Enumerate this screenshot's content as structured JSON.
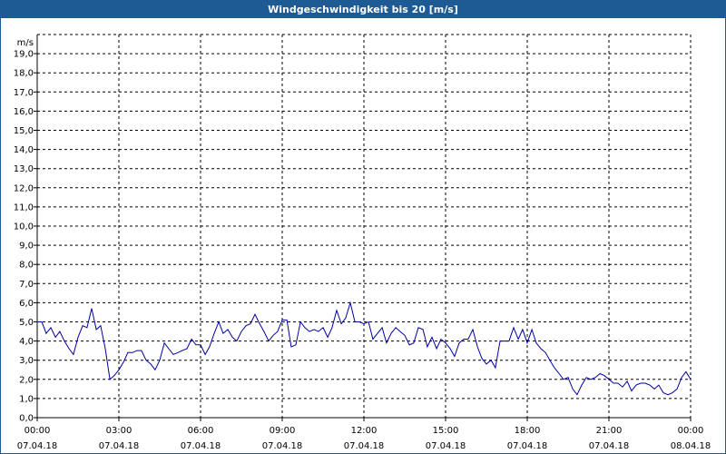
{
  "window": {
    "title": "Windgeschwindigkeit bis 20 [m/s]"
  },
  "colors": {
    "titlebar": "#1e5a94",
    "series": "#0000a0",
    "grid": "#000000"
  },
  "chart_data": {
    "type": "line",
    "title": "Windgeschwindigkeit bis 20 [m/s]",
    "ylabel": "m/s",
    "xlabel": "",
    "ylim": [
      0,
      20
    ],
    "xlim": [
      "07.04.18 00:00",
      "08.04.18 00:00"
    ],
    "grid": true,
    "y_ticks": [
      "0,0",
      "1,0",
      "2,0",
      "3,0",
      "4,0",
      "5,0",
      "6,0",
      "7,0",
      "8,0",
      "9,0",
      "10,0",
      "11,0",
      "12,0",
      "13,0",
      "14,0",
      "15,0",
      "16,0",
      "17,0",
      "18,0",
      "19,0"
    ],
    "x_ticks": [
      {
        "time": "00:00",
        "date": "07.04.18"
      },
      {
        "time": "03:00",
        "date": "07.04.18"
      },
      {
        "time": "06:00",
        "date": "07.04.18"
      },
      {
        "time": "09:00",
        "date": "07.04.18"
      },
      {
        "time": "12:00",
        "date": "07.04.18"
      },
      {
        "time": "15:00",
        "date": "07.04.18"
      },
      {
        "time": "18:00",
        "date": "07.04.18"
      },
      {
        "time": "21:00",
        "date": "07.04.18"
      },
      {
        "time": "00:00",
        "date": "08.04.18"
      }
    ],
    "series": [
      {
        "x_hours": [
          0,
          0.17,
          0.33,
          0.5,
          0.67,
          0.83,
          1.0,
          1.17,
          1.33,
          1.5,
          1.67,
          1.83,
          2.0,
          2.17,
          2.33,
          2.5,
          2.67,
          2.83,
          3.0,
          3.17,
          3.33,
          3.5,
          3.67,
          3.83,
          4.0,
          4.17,
          4.33,
          4.5,
          4.67,
          4.83,
          5.0,
          5.17,
          5.33,
          5.5,
          5.67,
          5.83,
          6.0,
          6.17,
          6.33,
          6.5,
          6.67,
          6.83,
          7.0,
          7.17,
          7.33,
          7.5,
          7.67,
          7.83,
          8.0,
          8.17,
          8.33,
          8.5,
          8.67,
          8.83,
          9.0,
          9.17,
          9.33,
          9.5,
          9.67,
          9.83,
          10.0,
          10.17,
          10.33,
          10.5,
          10.67,
          10.83,
          11.0,
          11.17,
          11.33,
          11.5,
          11.67,
          11.83,
          12.0,
          12.17,
          12.33,
          12.5,
          12.67,
          12.83,
          13.0,
          13.17,
          13.33,
          13.5,
          13.67,
          13.83,
          14.0,
          14.17,
          14.33,
          14.5,
          14.67,
          14.83,
          15.0,
          15.17,
          15.33,
          15.5,
          15.67,
          15.83,
          16.0,
          16.17,
          16.33,
          16.5,
          16.67,
          16.83,
          17.0,
          17.17,
          17.33,
          17.5,
          17.67,
          17.83,
          18.0,
          18.17,
          18.33,
          18.5,
          18.67,
          18.83,
          19.0,
          19.17,
          19.33,
          19.5,
          19.67,
          19.83,
          20.0,
          20.17,
          20.33,
          20.5,
          20.67,
          20.83,
          21.0,
          21.17,
          21.33,
          21.5,
          21.67,
          21.83,
          22.0,
          22.17,
          22.33,
          22.5,
          22.67,
          22.83,
          23.0,
          23.17,
          23.33,
          23.5,
          23.67,
          23.83,
          24.0
        ],
        "values": [
          5.0,
          5.0,
          4.4,
          4.7,
          4.2,
          4.5,
          4.0,
          3.6,
          3.3,
          4.2,
          4.8,
          4.7,
          5.7,
          4.6,
          4.8,
          3.6,
          2.0,
          2.2,
          2.5,
          2.9,
          3.4,
          3.4,
          3.5,
          3.5,
          3.0,
          2.8,
          2.5,
          3.0,
          3.9,
          3.6,
          3.3,
          3.4,
          3.5,
          3.6,
          4.1,
          3.8,
          3.8,
          3.3,
          3.7,
          4.4,
          5.0,
          4.4,
          4.6,
          4.2,
          4.0,
          4.5,
          4.8,
          4.9,
          5.4,
          4.9,
          4.5,
          4.0,
          4.3,
          4.5,
          5.1,
          5.1,
          3.7,
          3.8,
          5.0,
          4.7,
          4.5,
          4.6,
          4.5,
          4.7,
          4.2,
          4.7,
          5.6,
          4.9,
          5.2,
          6.0,
          5.0,
          5.0,
          4.9,
          5.0,
          4.1,
          4.4,
          4.7,
          3.9,
          4.4,
          4.7,
          4.5,
          4.3,
          3.8,
          3.9,
          4.7,
          4.6,
          3.7,
          4.2,
          3.6,
          4.1,
          3.9,
          3.6,
          3.2,
          3.9,
          4.1,
          4.1,
          4.6,
          3.7,
          3.1,
          2.8,
          3.0,
          2.6,
          4.0,
          4.0,
          4.0,
          4.7,
          4.1,
          4.6,
          3.9,
          4.6,
          3.9,
          3.6,
          3.4,
          3.0,
          2.6,
          2.3,
          2.0,
          2.1,
          1.5,
          1.2,
          1.7,
          2.1,
          2.0,
          2.1,
          2.3,
          2.2,
          2.0,
          1.8,
          1.8,
          1.6,
          1.9,
          1.4,
          1.7,
          1.8,
          1.8,
          1.7,
          1.5,
          1.7,
          1.3,
          1.2,
          1.3,
          1.5,
          2.1,
          2.4,
          2.0,
          1.7,
          1.3,
          1.2,
          1.1
        ]
      }
    ]
  }
}
